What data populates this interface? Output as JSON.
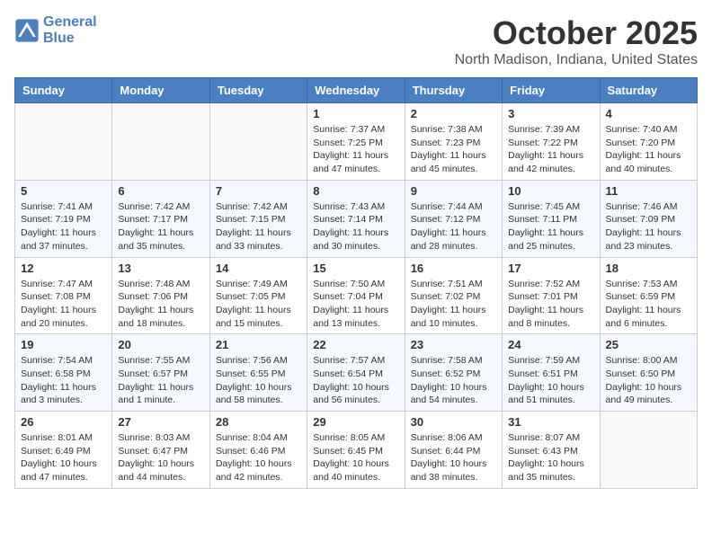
{
  "header": {
    "logo_line1": "General",
    "logo_line2": "Blue",
    "month": "October 2025",
    "location": "North Madison, Indiana, United States"
  },
  "days_of_week": [
    "Sunday",
    "Monday",
    "Tuesday",
    "Wednesday",
    "Thursday",
    "Friday",
    "Saturday"
  ],
  "weeks": [
    [
      {
        "day": "",
        "info": ""
      },
      {
        "day": "",
        "info": ""
      },
      {
        "day": "",
        "info": ""
      },
      {
        "day": "1",
        "info": "Sunrise: 7:37 AM\nSunset: 7:25 PM\nDaylight: 11 hours\nand 47 minutes."
      },
      {
        "day": "2",
        "info": "Sunrise: 7:38 AM\nSunset: 7:23 PM\nDaylight: 11 hours\nand 45 minutes."
      },
      {
        "day": "3",
        "info": "Sunrise: 7:39 AM\nSunset: 7:22 PM\nDaylight: 11 hours\nand 42 minutes."
      },
      {
        "day": "4",
        "info": "Sunrise: 7:40 AM\nSunset: 7:20 PM\nDaylight: 11 hours\nand 40 minutes."
      }
    ],
    [
      {
        "day": "5",
        "info": "Sunrise: 7:41 AM\nSunset: 7:19 PM\nDaylight: 11 hours\nand 37 minutes."
      },
      {
        "day": "6",
        "info": "Sunrise: 7:42 AM\nSunset: 7:17 PM\nDaylight: 11 hours\nand 35 minutes."
      },
      {
        "day": "7",
        "info": "Sunrise: 7:42 AM\nSunset: 7:15 PM\nDaylight: 11 hours\nand 33 minutes."
      },
      {
        "day": "8",
        "info": "Sunrise: 7:43 AM\nSunset: 7:14 PM\nDaylight: 11 hours\nand 30 minutes."
      },
      {
        "day": "9",
        "info": "Sunrise: 7:44 AM\nSunset: 7:12 PM\nDaylight: 11 hours\nand 28 minutes."
      },
      {
        "day": "10",
        "info": "Sunrise: 7:45 AM\nSunset: 7:11 PM\nDaylight: 11 hours\nand 25 minutes."
      },
      {
        "day": "11",
        "info": "Sunrise: 7:46 AM\nSunset: 7:09 PM\nDaylight: 11 hours\nand 23 minutes."
      }
    ],
    [
      {
        "day": "12",
        "info": "Sunrise: 7:47 AM\nSunset: 7:08 PM\nDaylight: 11 hours\nand 20 minutes."
      },
      {
        "day": "13",
        "info": "Sunrise: 7:48 AM\nSunset: 7:06 PM\nDaylight: 11 hours\nand 18 minutes."
      },
      {
        "day": "14",
        "info": "Sunrise: 7:49 AM\nSunset: 7:05 PM\nDaylight: 11 hours\nand 15 minutes."
      },
      {
        "day": "15",
        "info": "Sunrise: 7:50 AM\nSunset: 7:04 PM\nDaylight: 11 hours\nand 13 minutes."
      },
      {
        "day": "16",
        "info": "Sunrise: 7:51 AM\nSunset: 7:02 PM\nDaylight: 11 hours\nand 10 minutes."
      },
      {
        "day": "17",
        "info": "Sunrise: 7:52 AM\nSunset: 7:01 PM\nDaylight: 11 hours\nand 8 minutes."
      },
      {
        "day": "18",
        "info": "Sunrise: 7:53 AM\nSunset: 6:59 PM\nDaylight: 11 hours\nand 6 minutes."
      }
    ],
    [
      {
        "day": "19",
        "info": "Sunrise: 7:54 AM\nSunset: 6:58 PM\nDaylight: 11 hours\nand 3 minutes."
      },
      {
        "day": "20",
        "info": "Sunrise: 7:55 AM\nSunset: 6:57 PM\nDaylight: 11 hours\nand 1 minute."
      },
      {
        "day": "21",
        "info": "Sunrise: 7:56 AM\nSunset: 6:55 PM\nDaylight: 10 hours\nand 58 minutes."
      },
      {
        "day": "22",
        "info": "Sunrise: 7:57 AM\nSunset: 6:54 PM\nDaylight: 10 hours\nand 56 minutes."
      },
      {
        "day": "23",
        "info": "Sunrise: 7:58 AM\nSunset: 6:52 PM\nDaylight: 10 hours\nand 54 minutes."
      },
      {
        "day": "24",
        "info": "Sunrise: 7:59 AM\nSunset: 6:51 PM\nDaylight: 10 hours\nand 51 minutes."
      },
      {
        "day": "25",
        "info": "Sunrise: 8:00 AM\nSunset: 6:50 PM\nDaylight: 10 hours\nand 49 minutes."
      }
    ],
    [
      {
        "day": "26",
        "info": "Sunrise: 8:01 AM\nSunset: 6:49 PM\nDaylight: 10 hours\nand 47 minutes."
      },
      {
        "day": "27",
        "info": "Sunrise: 8:03 AM\nSunset: 6:47 PM\nDaylight: 10 hours\nand 44 minutes."
      },
      {
        "day": "28",
        "info": "Sunrise: 8:04 AM\nSunset: 6:46 PM\nDaylight: 10 hours\nand 42 minutes."
      },
      {
        "day": "29",
        "info": "Sunrise: 8:05 AM\nSunset: 6:45 PM\nDaylight: 10 hours\nand 40 minutes."
      },
      {
        "day": "30",
        "info": "Sunrise: 8:06 AM\nSunset: 6:44 PM\nDaylight: 10 hours\nand 38 minutes."
      },
      {
        "day": "31",
        "info": "Sunrise: 8:07 AM\nSunset: 6:43 PM\nDaylight: 10 hours\nand 35 minutes."
      },
      {
        "day": "",
        "info": ""
      }
    ]
  ]
}
